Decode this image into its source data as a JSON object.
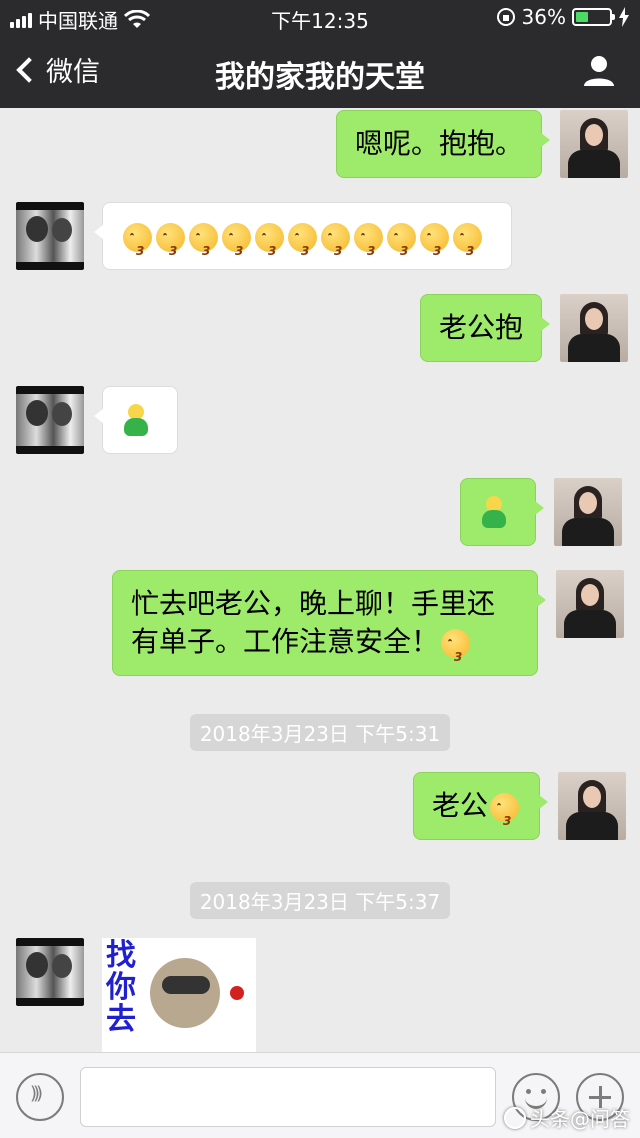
{
  "status_bar": {
    "carrier": "中国联通",
    "time": "下午12:35",
    "battery": "36%",
    "battery_level": 0.36,
    "colors": {
      "battery_fill": "#4cd964"
    }
  },
  "nav": {
    "back_label": "微信",
    "title": "我的家我的天堂",
    "profile_icon": "person-icon"
  },
  "messages": [
    {
      "side": "right",
      "text": "嗯呢。抱抱。"
    },
    {
      "side": "left",
      "emoji": "kissing-face",
      "emoji_count": 11
    },
    {
      "side": "right",
      "text": "老公抱"
    },
    {
      "side": "left",
      "sticker": "green-man-sticker"
    },
    {
      "side": "right",
      "sticker": "green-man-sticker"
    },
    {
      "side": "right",
      "text": "忙去吧老公，晚上聊！手里还有单子。工作注意安全！",
      "trailing_emoji": "kissing-face"
    },
    {
      "type": "timestamp",
      "text": "2018年3月23日 下午5:31"
    },
    {
      "side": "right",
      "text": "老公",
      "trailing_emoji": "kissing-face"
    },
    {
      "type": "timestamp",
      "text": "2018年3月23日 下午5:37"
    },
    {
      "side": "left",
      "image_sticker": "raccoon-rose-sticker",
      "sticker_text": "找你去"
    }
  ],
  "input_bar": {
    "voice_icon": "voice-icon",
    "emoji_icon": "emoji-icon",
    "plus_icon": "plus-icon",
    "placeholder": ""
  },
  "watermark": "头条@问答",
  "colors": {
    "green_bubble": "#9eea6a",
    "background": "#ebebeb",
    "header": "#2b2b2d"
  }
}
